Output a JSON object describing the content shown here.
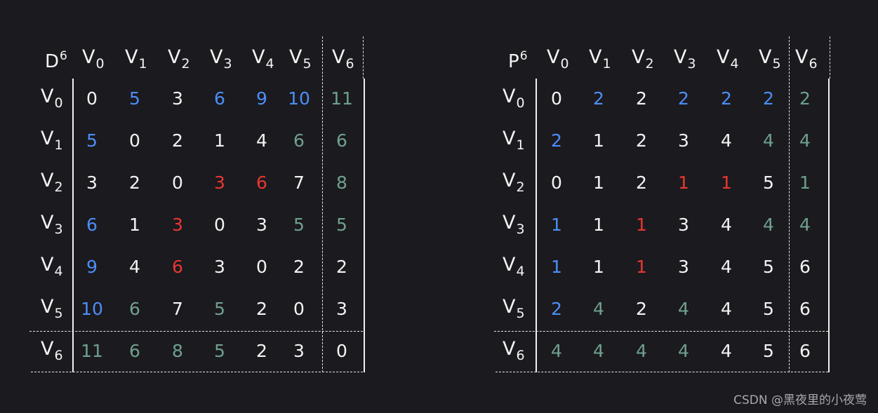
{
  "matrices": [
    {
      "id": "D",
      "base": "D",
      "sup": "6",
      "col_labels": [
        [
          "V",
          "0"
        ],
        [
          "V",
          "1"
        ],
        [
          "V",
          "2"
        ],
        [
          "V",
          "3"
        ],
        [
          "V",
          "4"
        ],
        [
          "V",
          "5"
        ],
        [
          "V",
          "6"
        ]
      ],
      "row_labels": [
        [
          "V",
          "0"
        ],
        [
          "V",
          "1"
        ],
        [
          "V",
          "2"
        ],
        [
          "V",
          "3"
        ],
        [
          "V",
          "4"
        ],
        [
          "V",
          "5"
        ],
        [
          "V",
          "6"
        ]
      ],
      "rows": [
        [
          [
            "0",
            "white"
          ],
          [
            "5",
            "blue"
          ],
          [
            "3",
            "white"
          ],
          [
            "6",
            "blue"
          ],
          [
            "9",
            "blue"
          ],
          [
            "10",
            "blue"
          ],
          [
            "11",
            "green"
          ]
        ],
        [
          [
            "5",
            "blue"
          ],
          [
            "0",
            "white"
          ],
          [
            "2",
            "white"
          ],
          [
            "1",
            "white"
          ],
          [
            "4",
            "white"
          ],
          [
            "6",
            "green"
          ],
          [
            "6",
            "green"
          ]
        ],
        [
          [
            "3",
            "white"
          ],
          [
            "2",
            "white"
          ],
          [
            "0",
            "white"
          ],
          [
            "3",
            "red"
          ],
          [
            "6",
            "red"
          ],
          [
            "7",
            "white"
          ],
          [
            "8",
            "green"
          ]
        ],
        [
          [
            "6",
            "blue"
          ],
          [
            "1",
            "white"
          ],
          [
            "3",
            "red"
          ],
          [
            "0",
            "white"
          ],
          [
            "3",
            "white"
          ],
          [
            "5",
            "green"
          ],
          [
            "5",
            "green"
          ]
        ],
        [
          [
            "9",
            "blue"
          ],
          [
            "4",
            "white"
          ],
          [
            "6",
            "red"
          ],
          [
            "3",
            "white"
          ],
          [
            "0",
            "white"
          ],
          [
            "2",
            "white"
          ],
          [
            "2",
            "white"
          ]
        ],
        [
          [
            "10",
            "blue"
          ],
          [
            "6",
            "green"
          ],
          [
            "7",
            "white"
          ],
          [
            "5",
            "green"
          ],
          [
            "2",
            "white"
          ],
          [
            "0",
            "white"
          ],
          [
            "3",
            "white"
          ]
        ],
        [
          [
            "11",
            "green"
          ],
          [
            "6",
            "green"
          ],
          [
            "8",
            "green"
          ],
          [
            "5",
            "green"
          ],
          [
            "2",
            "white"
          ],
          [
            "3",
            "white"
          ],
          [
            "0",
            "white"
          ]
        ]
      ]
    },
    {
      "id": "P",
      "base": "P",
      "sup": "6",
      "col_labels": [
        [
          "V",
          "0"
        ],
        [
          "V",
          "1"
        ],
        [
          "V",
          "2"
        ],
        [
          "V",
          "3"
        ],
        [
          "V",
          "4"
        ],
        [
          "V",
          "5"
        ],
        [
          "V",
          "6"
        ]
      ],
      "row_labels": [
        [
          "V",
          "0"
        ],
        [
          "V",
          "1"
        ],
        [
          "V",
          "2"
        ],
        [
          "V",
          "3"
        ],
        [
          "V",
          "4"
        ],
        [
          "V",
          "5"
        ],
        [
          "V",
          "6"
        ]
      ],
      "rows": [
        [
          [
            "0",
            "white"
          ],
          [
            "2",
            "blue"
          ],
          [
            "2",
            "white"
          ],
          [
            "2",
            "blue"
          ],
          [
            "2",
            "blue"
          ],
          [
            "2",
            "blue"
          ],
          [
            "2",
            "green"
          ]
        ],
        [
          [
            "2",
            "blue"
          ],
          [
            "1",
            "white"
          ],
          [
            "2",
            "white"
          ],
          [
            "3",
            "white"
          ],
          [
            "4",
            "white"
          ],
          [
            "4",
            "green"
          ],
          [
            "4",
            "green"
          ]
        ],
        [
          [
            "0",
            "white"
          ],
          [
            "1",
            "white"
          ],
          [
            "2",
            "white"
          ],
          [
            "1",
            "red"
          ],
          [
            "1",
            "red"
          ],
          [
            "5",
            "white"
          ],
          [
            "1",
            "green"
          ]
        ],
        [
          [
            "1",
            "blue"
          ],
          [
            "1",
            "white"
          ],
          [
            "1",
            "red"
          ],
          [
            "3",
            "white"
          ],
          [
            "4",
            "white"
          ],
          [
            "4",
            "green"
          ],
          [
            "4",
            "green"
          ]
        ],
        [
          [
            "1",
            "blue"
          ],
          [
            "1",
            "white"
          ],
          [
            "1",
            "red"
          ],
          [
            "3",
            "white"
          ],
          [
            "4",
            "white"
          ],
          [
            "5",
            "white"
          ],
          [
            "6",
            "white"
          ]
        ],
        [
          [
            "2",
            "blue"
          ],
          [
            "4",
            "green"
          ],
          [
            "2",
            "white"
          ],
          [
            "4",
            "green"
          ],
          [
            "4",
            "white"
          ],
          [
            "5",
            "white"
          ],
          [
            "6",
            "white"
          ]
        ],
        [
          [
            "4",
            "green"
          ],
          [
            "4",
            "green"
          ],
          [
            "4",
            "green"
          ],
          [
            "4",
            "green"
          ],
          [
            "4",
            "white"
          ],
          [
            "5",
            "white"
          ],
          [
            "6",
            "white"
          ]
        ]
      ]
    }
  ],
  "colors": {
    "background": "#1b1a1f",
    "white": "#f4f4f4",
    "blue": "#4c8ef7",
    "red": "#e8372f",
    "green": "#6fa08e"
  },
  "watermark": "CSDN @黑夜里的小夜莺"
}
